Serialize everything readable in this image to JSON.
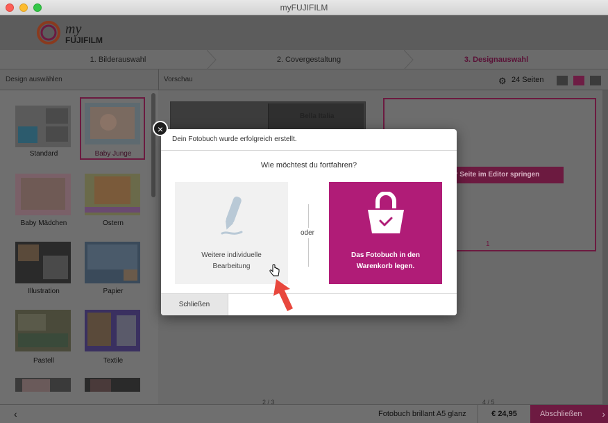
{
  "window": {
    "title": "myFUJIFILM"
  },
  "brand": {
    "logo_script": "my",
    "logo_text": "FUJIFILM",
    "accent": "#b01c77"
  },
  "steps": [
    {
      "label": "1. Bilderauswahl"
    },
    {
      "label": "2. Covergestaltung"
    },
    {
      "label": "3. Designauswahl"
    }
  ],
  "subbar": {
    "left_label": "Design auswählen",
    "preview_label": "Vorschau",
    "pages_label": "24 Seiten"
  },
  "designs": [
    {
      "label": "Standard"
    },
    {
      "label": "Baby Junge"
    },
    {
      "label": "Baby Mädchen"
    },
    {
      "label": "Ostern"
    },
    {
      "label": "Illustration"
    },
    {
      "label": "Papier"
    },
    {
      "label": "Pastell"
    },
    {
      "label": "Textile"
    }
  ],
  "preview": {
    "left_page_title": "Bella Italia",
    "editor_jump": "er Seite  im Editor springen",
    "page_number": "1",
    "left_counter": "2 / 3",
    "right_counter": "4 / 5"
  },
  "footer": {
    "back_icon": "‹",
    "product": "Fotobuch brillant A5 glanz",
    "price": "€ 24,95",
    "finish": "Abschließen",
    "finish_icon": "›"
  },
  "modal": {
    "header": "Dein Fotobuch wurde erfolgreich erstellt.",
    "question": "Wie möchtest du fortfahren?",
    "edit_line1": "Weitere individuelle",
    "edit_line2": "Bearbeitung",
    "or": "oder",
    "cart_line1": "Das Fotobuch in den",
    "cart_line2": "Warenkorb legen.",
    "close_button": "Schließen",
    "close_icon": "×"
  }
}
